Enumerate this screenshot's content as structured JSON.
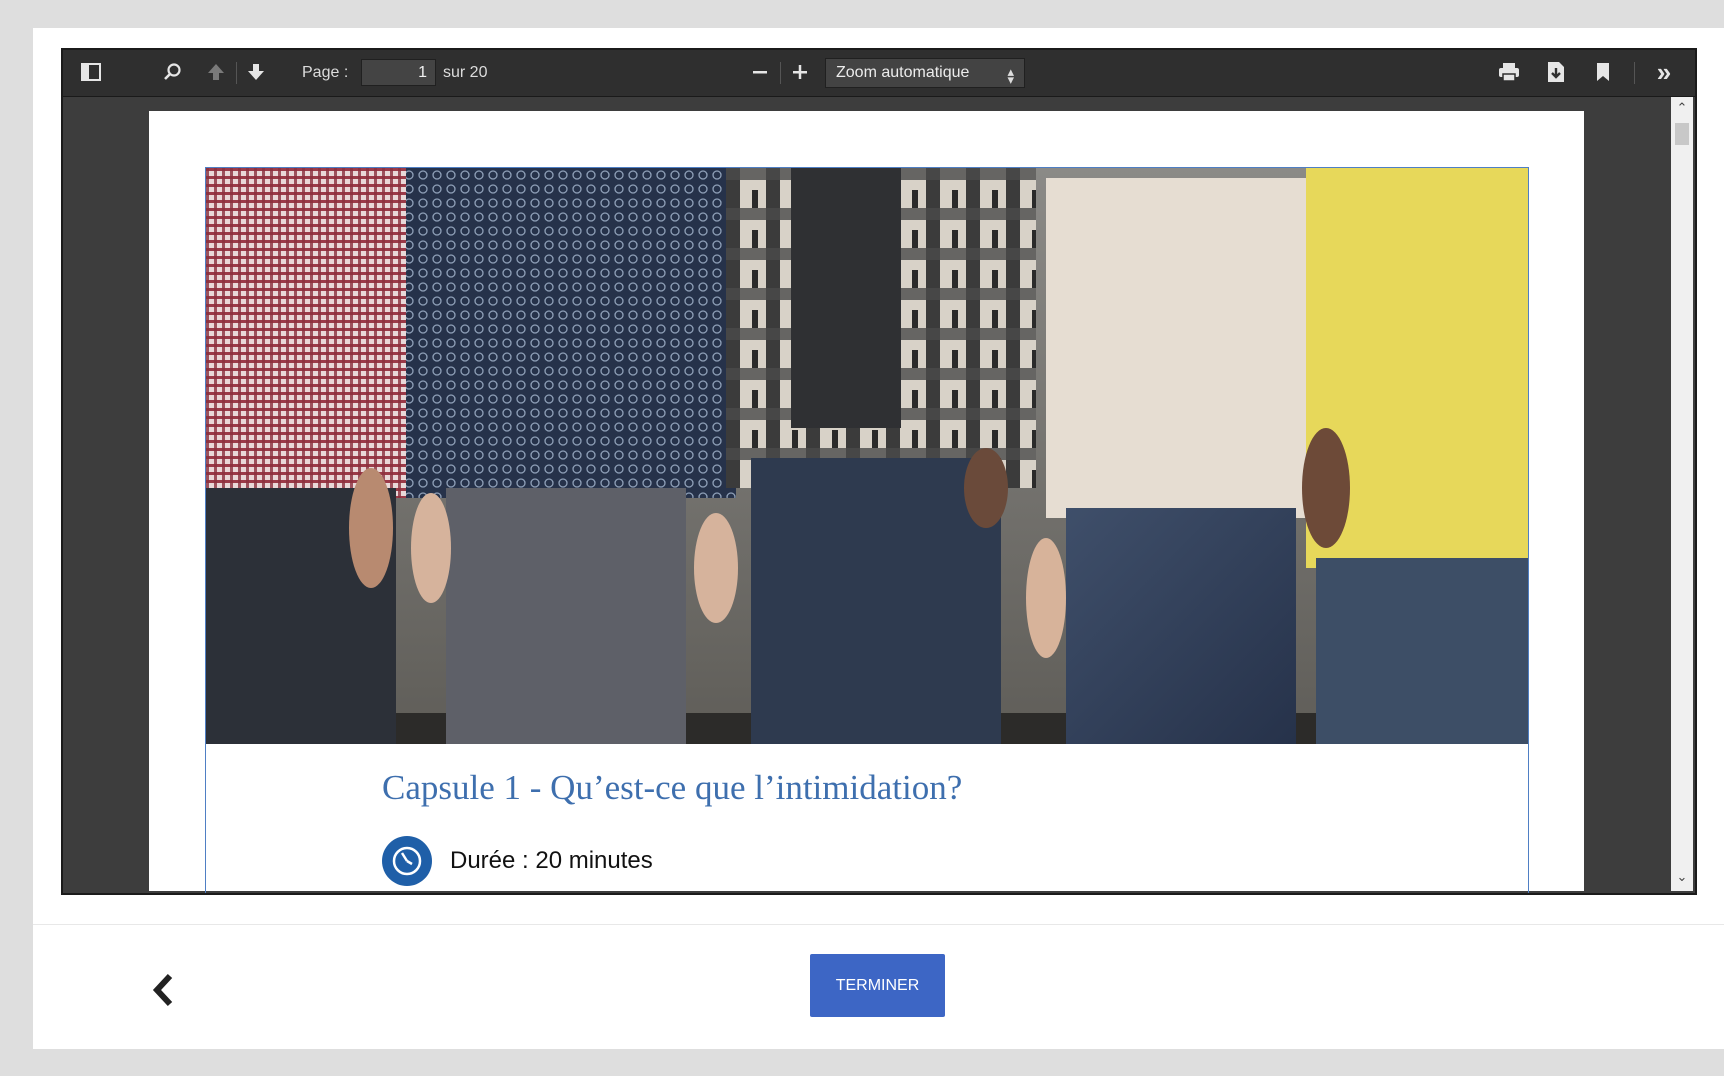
{
  "pdf_viewer": {
    "toolbar": {
      "page_label": "Page :",
      "page_value": "1",
      "page_total": "sur 20",
      "zoom_value": "Zoom automatique",
      "icons": [
        "sidebar-toggle-icon",
        "search-icon",
        "previous-page-icon",
        "next-page-icon",
        "zoom-out-icon",
        "zoom-in-icon",
        "print-icon",
        "download-icon",
        "bookmark-icon",
        "tools-icon"
      ]
    },
    "document": {
      "title": "Capsule 1 - Qu’est-ce que l’intimidation?",
      "duration": "Durée : 20 minutes",
      "image_description_icon": "people-standing-photo"
    }
  },
  "footer": {
    "finish_label": "TERMINER",
    "back_icon": "chevron-left-icon"
  },
  "colors": {
    "toolbar_bg": "#2f2f2f",
    "title_blue": "#3e6fae",
    "button_blue": "#3d66c5",
    "clock_blue": "#1f5fa8"
  }
}
